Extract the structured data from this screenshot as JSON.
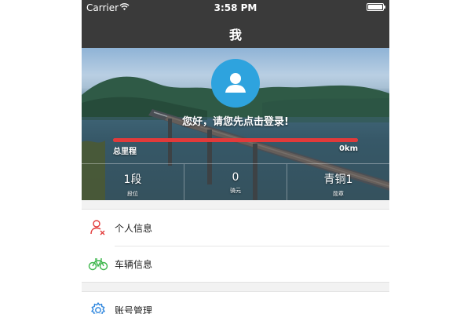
{
  "status_bar": {
    "carrier": "Carrier",
    "time": "3:58 PM"
  },
  "nav": {
    "title": "我"
  },
  "profile": {
    "login_prompt": "您好，请您先点击登录!",
    "mileage_label": "总里程",
    "mileage_value": "0km",
    "mileage_progress_percent": 100,
    "mileage_bar_color": "#e23a3a",
    "avatar_color": "#2ea3de",
    "stats": [
      {
        "value": "1段",
        "label": "段位"
      },
      {
        "value": "0",
        "label": "骑元"
      },
      {
        "value": "青铜1",
        "label": "勋章"
      }
    ]
  },
  "menu": {
    "group1": [
      {
        "label": "个人信息",
        "icon": "person-icon",
        "icon_color": "#e23a3a"
      },
      {
        "label": "车辆信息",
        "icon": "bicycle-icon",
        "icon_color": "#3cb64a"
      }
    ],
    "group2": [
      {
        "label": "账号管理",
        "icon": "gear-icon",
        "icon_color": "#2e86de"
      }
    ]
  }
}
